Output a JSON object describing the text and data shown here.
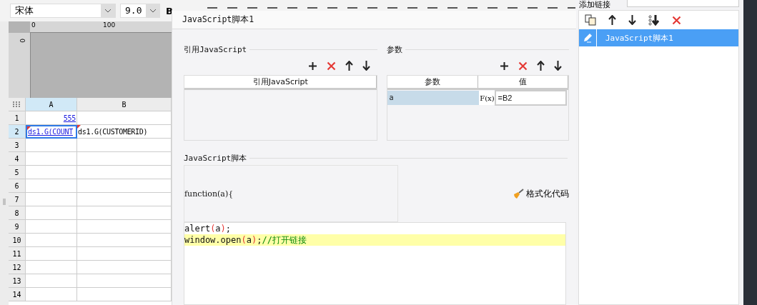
{
  "toolbar": {
    "font": "宋体",
    "size": "9.0",
    "bold_button": "B"
  },
  "ruler": {
    "ticks": [
      "0",
      "100"
    ],
    "vertical_tick": "0"
  },
  "sheet": {
    "columns": [
      {
        "label": "A",
        "selected": true
      },
      {
        "label": "B",
        "selected": false
      }
    ],
    "rows": [
      {
        "label": "1",
        "selected": false,
        "cells": [
          {
            "text": "555",
            "kind": "number",
            "link": true,
            "selected": false,
            "flag": false
          }
        ]
      },
      {
        "label": "2",
        "selected": true,
        "cells": [
          {
            "text": "ds1.G(COUNT",
            "kind": "text",
            "link": true,
            "selected": true,
            "flag": true
          },
          {
            "text": "ds1.G(CUSTOMERID)",
            "kind": "text",
            "link": false,
            "selected": false,
            "flag": true
          }
        ]
      },
      {
        "label": "3",
        "selected": false
      },
      {
        "label": "4",
        "selected": false
      },
      {
        "label": "5",
        "selected": false
      },
      {
        "label": "6",
        "selected": false
      },
      {
        "label": "7",
        "selected": false
      },
      {
        "label": "8",
        "selected": false
      },
      {
        "label": "9",
        "selected": false
      },
      {
        "label": "10",
        "selected": false
      },
      {
        "label": "11",
        "selected": false
      },
      {
        "label": "12",
        "selected": false
      },
      {
        "label": "13",
        "selected": false
      },
      {
        "label": "14",
        "selected": false
      }
    ]
  },
  "dialog": {
    "title": "JavaScript脚本1",
    "reference": {
      "title": "引用JavaScript",
      "column": "引用JavaScript"
    },
    "parameters": {
      "title": "参数",
      "columns": [
        "参数",
        "值"
      ],
      "rows": [
        {
          "name": "a",
          "formula_button": "F(x)",
          "value": "=B2",
          "selected": true
        }
      ]
    },
    "script": {
      "title": "JavaScript脚本",
      "header": "function(a){",
      "format_button": "格式化代码",
      "lines": [
        {
          "code": "alert(a);",
          "highlighted": false
        },
        {
          "code": "window.open(a);",
          "comment": "//打开链接",
          "highlighted": true
        }
      ]
    }
  },
  "side_panel": {
    "label": "添加链接",
    "items": [
      {
        "label": "JavaScript脚本1",
        "selected": true
      }
    ]
  }
}
